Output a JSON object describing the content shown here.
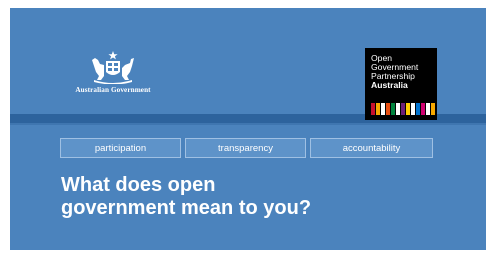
{
  "government": {
    "name": "Australian Government",
    "emblem_icon": "coat-of-arms-icon"
  },
  "ogp_logo": {
    "lines": [
      "Open",
      "Government",
      "Partnership"
    ],
    "country": "Australia",
    "bar_colors": [
      "#c8102e",
      "#f6a800",
      "#ffffff",
      "#e84e0f",
      "#00843d",
      "#ffffff",
      "#6d2077",
      "#ffcd00",
      "#ffffff",
      "#0072ce",
      "#d0006f",
      "#ffffff",
      "#f6a800"
    ]
  },
  "tags": [
    "participation",
    "transparency",
    "accountability"
  ],
  "headline": {
    "line1": "What does open",
    "line2": "government mean to you?"
  },
  "colors": {
    "background": "#4b83bd",
    "stripe": "#2d639d",
    "logo_box": "#000000"
  }
}
